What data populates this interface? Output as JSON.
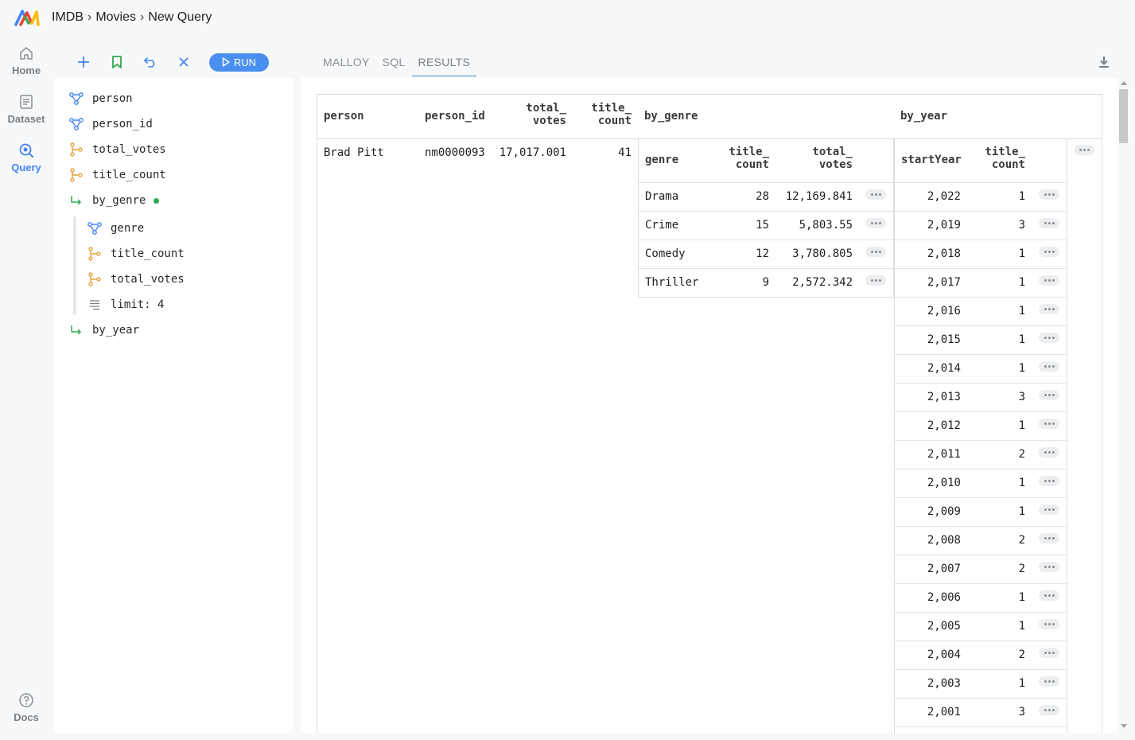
{
  "breadcrumb": [
    "IMDB",
    "Movies",
    "New Query"
  ],
  "breadcrumb_sep": "›",
  "rail": {
    "home": "Home",
    "dataset": "Dataset",
    "query": "Query",
    "docs": "Docs"
  },
  "toolbar": {
    "run_label": "RUN"
  },
  "tree": {
    "person": "person",
    "person_id": "person_id",
    "total_votes": "total_votes",
    "title_count": "title_count",
    "by_genre": "by_genre",
    "genre": "genre",
    "nested_title_count": "title_count",
    "nested_total_votes": "total_votes",
    "limit": "limit: 4",
    "by_year": "by_year"
  },
  "tabs": [
    "MALLOY",
    "SQL",
    "RESULTS"
  ],
  "active_tab": "RESULTS",
  "colors": {
    "accent": "#4285f4",
    "dimension": "#4285f4",
    "measure": "#e8a33d",
    "nest": "#34a853"
  },
  "results": {
    "headers": {
      "person": "person",
      "person_id": "person_id",
      "total_votes_1": "total_",
      "total_votes_2": "votes",
      "title_count_1": "title_",
      "title_count_2": "count",
      "by_genre": "by_genre",
      "by_year": "by_year"
    },
    "row": {
      "person": "Brad Pitt",
      "person_id": "nm0000093",
      "total_votes": "17,017.001",
      "title_count": "41"
    },
    "by_genre": {
      "headers": {
        "genre": "genre",
        "title_count_1": "title_",
        "title_count_2": "count",
        "total_votes_1": "total_",
        "total_votes_2": "votes"
      },
      "rows": [
        {
          "genre": "Drama",
          "title_count": "28",
          "total_votes": "12,169.841"
        },
        {
          "genre": "Crime",
          "title_count": "15",
          "total_votes": "5,803.55"
        },
        {
          "genre": "Comedy",
          "title_count": "12",
          "total_votes": "3,780.805"
        },
        {
          "genre": "Thriller",
          "title_count": "9",
          "total_votes": "2,572.342"
        }
      ]
    },
    "by_year": {
      "headers": {
        "startYear": "startYear",
        "title_count_1": "title_",
        "title_count_2": "count"
      },
      "rows": [
        {
          "year": "2,022",
          "count": "1"
        },
        {
          "year": "2,019",
          "count": "3"
        },
        {
          "year": "2,018",
          "count": "1"
        },
        {
          "year": "2,017",
          "count": "1"
        },
        {
          "year": "2,016",
          "count": "1"
        },
        {
          "year": "2,015",
          "count": "1"
        },
        {
          "year": "2,014",
          "count": "1"
        },
        {
          "year": "2,013",
          "count": "3"
        },
        {
          "year": "2,012",
          "count": "1"
        },
        {
          "year": "2,011",
          "count": "2"
        },
        {
          "year": "2,010",
          "count": "1"
        },
        {
          "year": "2,009",
          "count": "1"
        },
        {
          "year": "2,008",
          "count": "2"
        },
        {
          "year": "2,007",
          "count": "2"
        },
        {
          "year": "2,006",
          "count": "1"
        },
        {
          "year": "2,005",
          "count": "1"
        },
        {
          "year": "2,004",
          "count": "2"
        },
        {
          "year": "2,003",
          "count": "1"
        },
        {
          "year": "2,001",
          "count": "3"
        }
      ]
    }
  }
}
